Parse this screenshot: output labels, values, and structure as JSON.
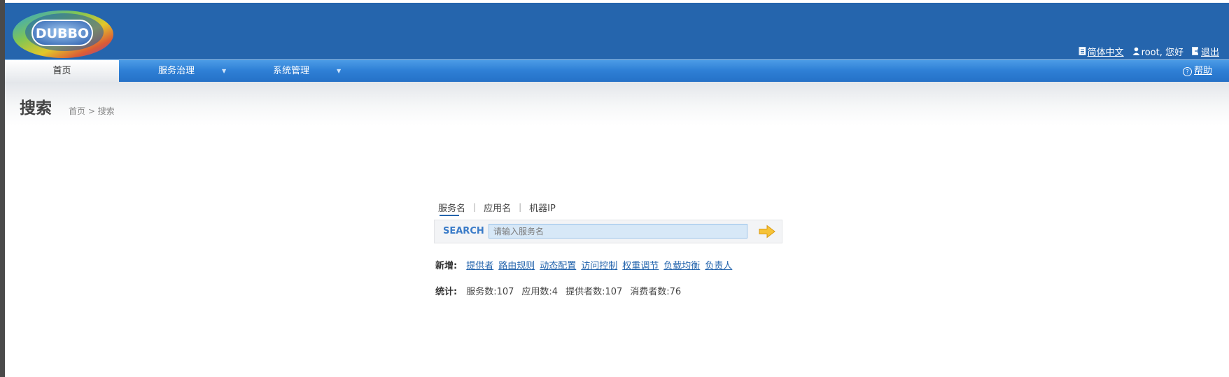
{
  "header": {
    "logo_text": "DUBBO",
    "language": "简体中文",
    "greeting": "root, 您好",
    "logout": "退出"
  },
  "nav": {
    "home": "首页",
    "governance": "服务治理",
    "system": "系统管理",
    "help": "帮助"
  },
  "page": {
    "title": "搜索",
    "breadcrumb": "首页 > 搜索"
  },
  "search": {
    "tabs": [
      "服务名",
      "应用名",
      "机器IP"
    ],
    "label": "SEARCH",
    "placeholder": "请输入服务名"
  },
  "add": {
    "label": "新增:",
    "links": [
      "提供者",
      "路由规则",
      "动态配置",
      "访问控制",
      "权重调节",
      "负载均衡",
      "负责人"
    ]
  },
  "stats": {
    "label": "统计:",
    "items": [
      "服务数:107",
      "应用数:4",
      "提供者数:107",
      "消费者数:76"
    ]
  },
  "colors": {
    "header_bg": "#2565ad",
    "nav_bg": "#2f80d6",
    "link": "#2565ad"
  }
}
